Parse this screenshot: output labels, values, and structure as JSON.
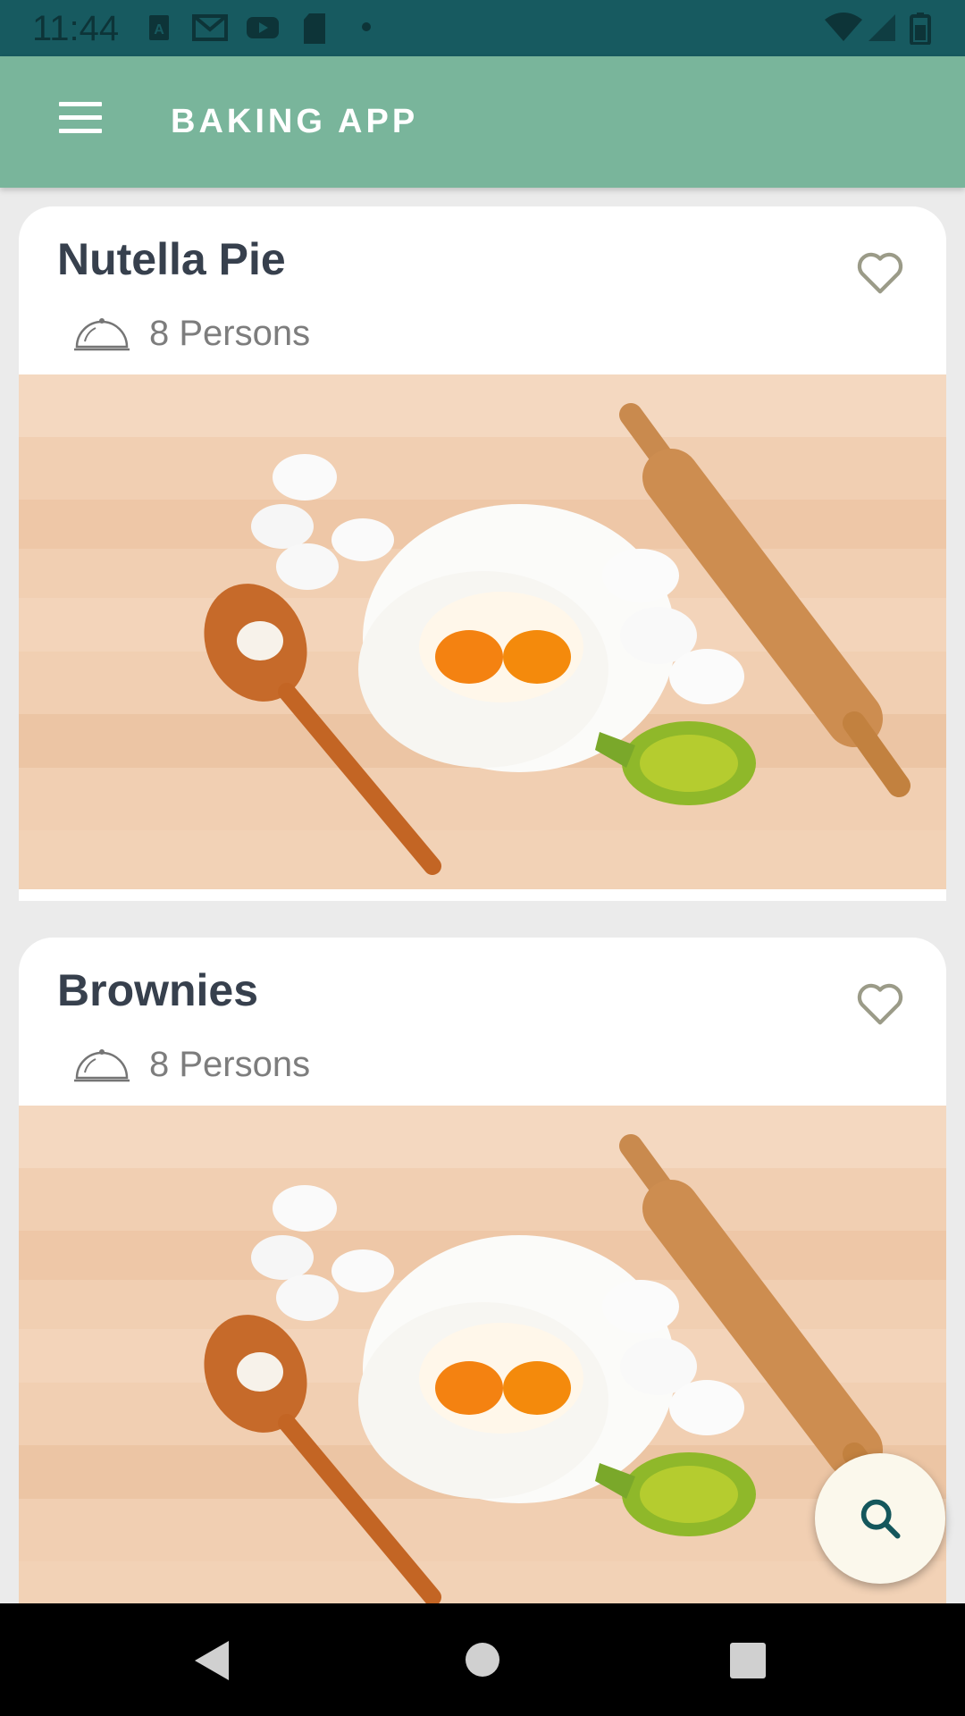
{
  "status_bar": {
    "time": "11:44",
    "icons": [
      "a-icon",
      "mail-icon",
      "youtube-icon",
      "sd-card-icon",
      "dot-icon",
      "wifi-icon",
      "signal-icon",
      "battery-icon"
    ]
  },
  "app_bar": {
    "title": "BAKING APP",
    "menu_icon": "hamburger-menu-icon",
    "background": "#79b59b"
  },
  "recipes": [
    {
      "name": "Nutella Pie",
      "servings": "8 Persons",
      "favorite": false
    },
    {
      "name": "Brownies",
      "servings": "8 Persons",
      "favorite": false
    }
  ],
  "fab": {
    "icon": "search-icon"
  },
  "nav_bar": {
    "icons": [
      "back-icon",
      "home-icon",
      "recents-icon"
    ]
  },
  "colors": {
    "status_bar": "#175a60",
    "title_text": "#37404d",
    "fab_icon": "#14575c"
  }
}
